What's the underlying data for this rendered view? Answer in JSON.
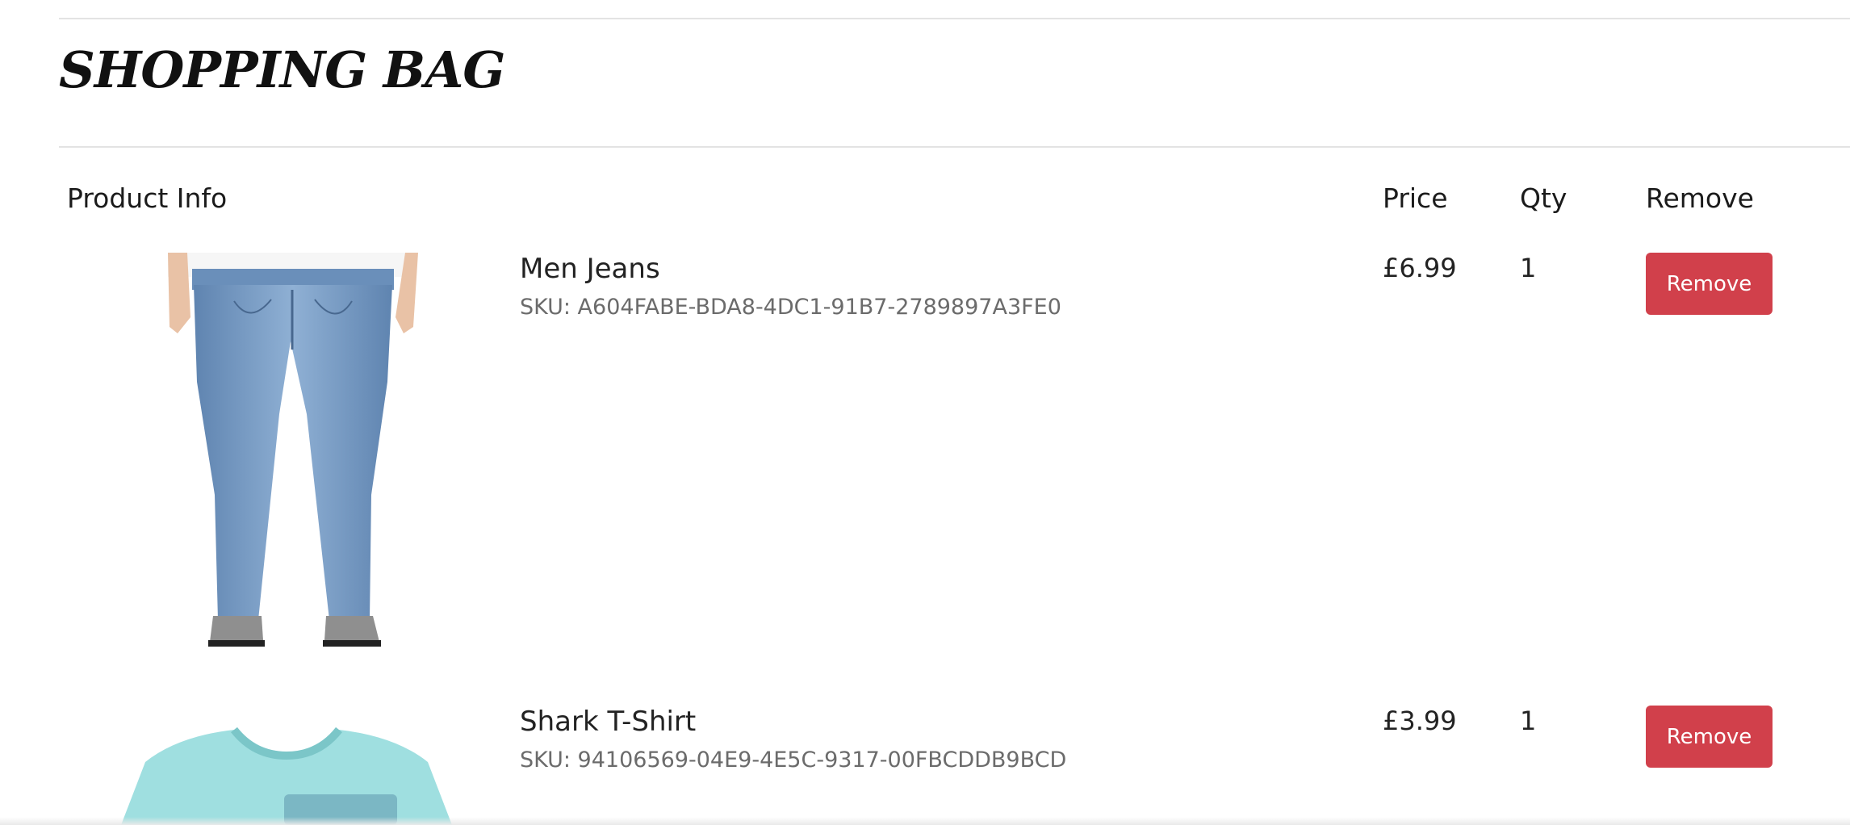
{
  "page": {
    "title": "SHOPPING BAG"
  },
  "table": {
    "headers": {
      "product": "Product Info",
      "price": "Price",
      "qty": "Qty",
      "remove": "Remove"
    },
    "items": [
      {
        "name": "Men Jeans",
        "sku": "SKU: A604FABE-BDA8-4DC1-91B7-2789897A3FE0",
        "price": "£6.99",
        "qty": "1",
        "remove_label": "Remove",
        "image_icon": "jeans-image"
      },
      {
        "name": "Shark T-Shirt",
        "sku": "SKU: 94106569-04E9-4E5C-9317-00FBCDDB9BCD",
        "price": "£3.99",
        "qty": "1",
        "remove_label": "Remove",
        "image_icon": "tshirt-image"
      }
    ]
  },
  "colors": {
    "remove_button": "#d1404b",
    "divider": "#e3e3e3",
    "sku_text": "#6b6b6b"
  }
}
